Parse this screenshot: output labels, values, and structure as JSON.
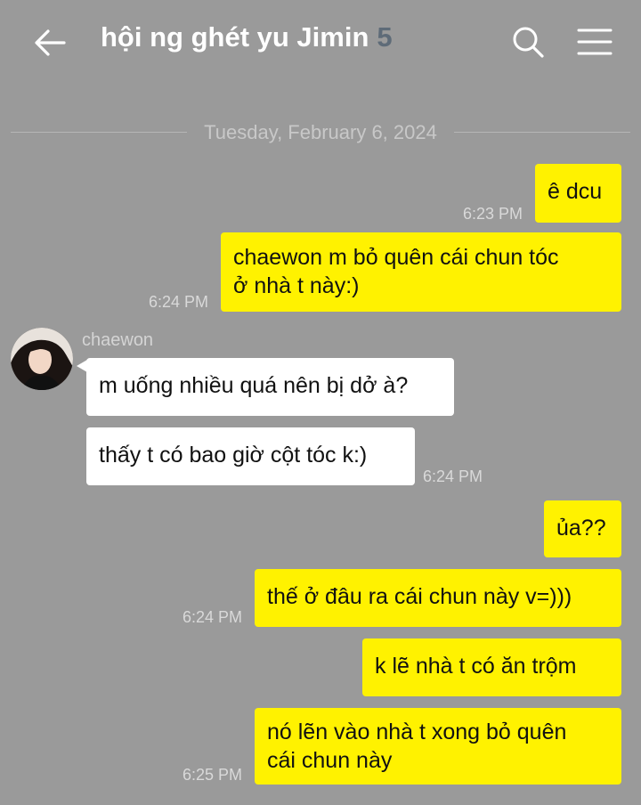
{
  "header": {
    "title": "hội ng ghét yu Jimin",
    "member_count": "5"
  },
  "date_separator": "Tuesday, February 6, 2024",
  "messages": [
    {
      "text_lines": [
        "ê dcu"
      ],
      "time": "6:23 PM",
      "from": "me"
    },
    {
      "text_lines": [
        "chaewon m bỏ quên cái chun tóc",
        "ở nhà t này:)"
      ],
      "time": "6:24 PM",
      "from": "me"
    },
    {
      "text_lines": [
        "m uống nhiều quá nên bị dở à?"
      ],
      "time": "",
      "from": "chaewon"
    },
    {
      "text_lines": [
        "thấy t có bao giờ cột tóc k:)"
      ],
      "time": "6:24 PM",
      "from": "chaewon"
    },
    {
      "text_lines": [
        "ủa??"
      ],
      "time": "",
      "from": "me"
    },
    {
      "text_lines": [
        "thế ở đâu ra cái chun này v=)))"
      ],
      "time": "6:24 PM",
      "from": "me"
    },
    {
      "text_lines": [
        "k lẽ nhà t có ăn trộm"
      ],
      "time": "",
      "from": "me"
    },
    {
      "text_lines": [
        "nó lẽn vào nhà t xong bỏ quên",
        "cái chun này"
      ],
      "time": "6:25 PM",
      "from": "me"
    }
  ],
  "sender_name": "chaewon",
  "colors": {
    "background": "#9a9a9a",
    "my_bubble": "#fff200",
    "other_bubble": "#ffffff",
    "member_count": "#5e6b78"
  },
  "icons": [
    "back-arrow-icon",
    "search-icon",
    "menu-icon"
  ]
}
